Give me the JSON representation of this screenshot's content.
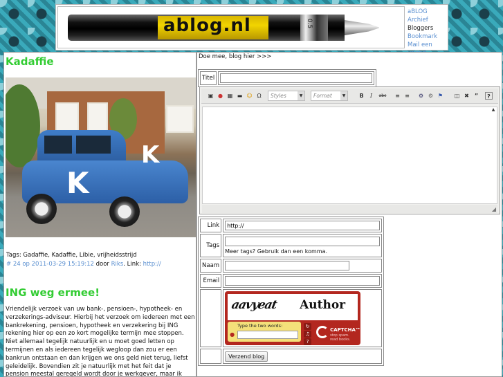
{
  "header": {
    "logo_text": "ablog.nl",
    "nav": [
      {
        "label": "aBLOG",
        "link": true
      },
      {
        "label": "Archief",
        "link": true
      },
      {
        "label": "Bloggers",
        "link": false
      },
      {
        "label": "Bookmark",
        "link": true
      },
      {
        "label": "Mail een vriend",
        "link": true
      }
    ]
  },
  "post1": {
    "title": "Kadaffie",
    "tags_label": "Tags:",
    "tags": "Gadaffie, Kadaffie, Libie, vrijheidsstrijd",
    "permalink": "# 24",
    "date_text": "op 2011-03-29 15:19:12",
    "by": "door",
    "author": "Riks",
    "link_label": "Link:",
    "link": "http://"
  },
  "post2": {
    "title": "ING weg ermee!",
    "body": "Vriendelijk verzoek van uw bank-, pensioen-, hypotheek- en verzekerings-adviseur. Hierbij het verzoek om iedereen met een bankrekening, pensioen, hypotheek en verzekering bij ING rekening hier op een zo kort mogelijke termijn mee stoppen. Niet allemaal tegelijk natuurlijk en u moet goed letten op termijnen en als iedereen tegelijk wegloop dan zou er een bankrun ontstaan en dan krijgen we ons geld niet terug, liefst geleidelijk. Bovendien zit je natuurlijk met het feit dat je pension meestal geregeld wordt door je werkgever, maar ik hoop dat werkgevers, vooral de kleinere weg gaan bij de ING met hun pensioen of in ieder geval geen nieuwe af te sluiten."
  },
  "form": {
    "intro": "Doe mee, blog hier >>>",
    "title_label": "Titel",
    "title_value": "",
    "editor": {
      "styles_placeholder": "Styles",
      "format_placeholder": "Format",
      "bold": "B",
      "italic": "I",
      "strike": "abc",
      "quote": "”",
      "help": "?"
    },
    "link_label": "Link",
    "link_value": "http://",
    "tags_label": "Tags",
    "tags_value": "",
    "tags_hint": "Meer tags? Gebruik dan een komma.",
    "name_label": "Naam",
    "name_value": "",
    "email_label": "Email",
    "email_value": "",
    "captcha": {
      "word1": "aavyeat",
      "word2": "Author",
      "prompt": "Type the two words:",
      "brand": "CAPTCHA™",
      "tagline": "stop spam. read books."
    },
    "submit_label": "Verzend blog"
  }
}
